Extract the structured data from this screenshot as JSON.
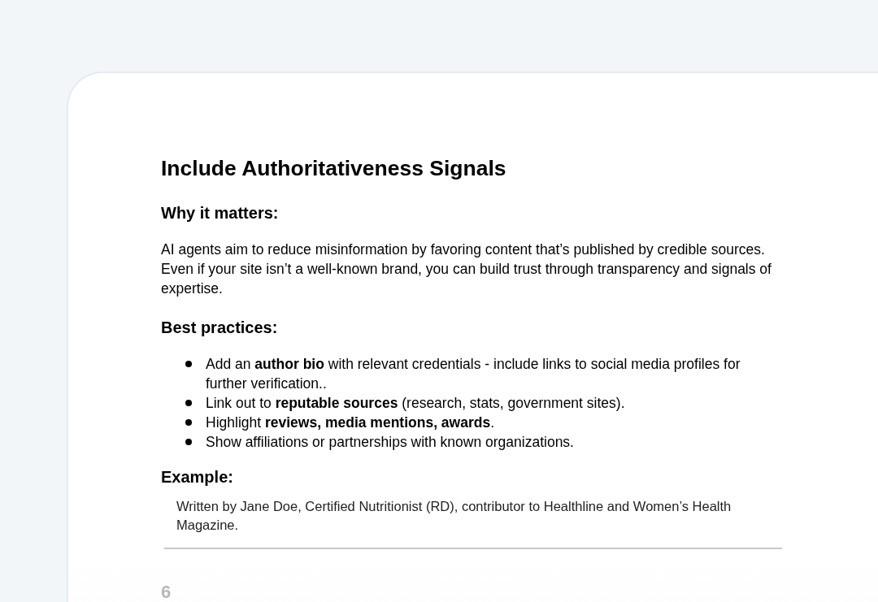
{
  "title": "Include Authoritativeness Signals",
  "why": {
    "heading": "Why it matters:",
    "text": "AI agents aim to reduce misinformation by favoring content that’s published by credible sources. Even if your site isn’t a well-known brand, you can build trust through transparency and signals of expertise."
  },
  "practices": {
    "heading": "Best practices:",
    "items": [
      "Add an **author bio** with relevant credentials - include links to social media profiles for further verification..",
      "Link out to **reputable sources** (research, stats, government sites).",
      "Highlight **reviews, media mentions, awards**.",
      "Show affiliations or partnerships with known organizations."
    ]
  },
  "example": {
    "heading": "Example:",
    "text": "Written by Jane Doe, Certified Nutritionist (RD), contributor to Healthline and Women’s Health Magazine."
  },
  "next_number": "6"
}
